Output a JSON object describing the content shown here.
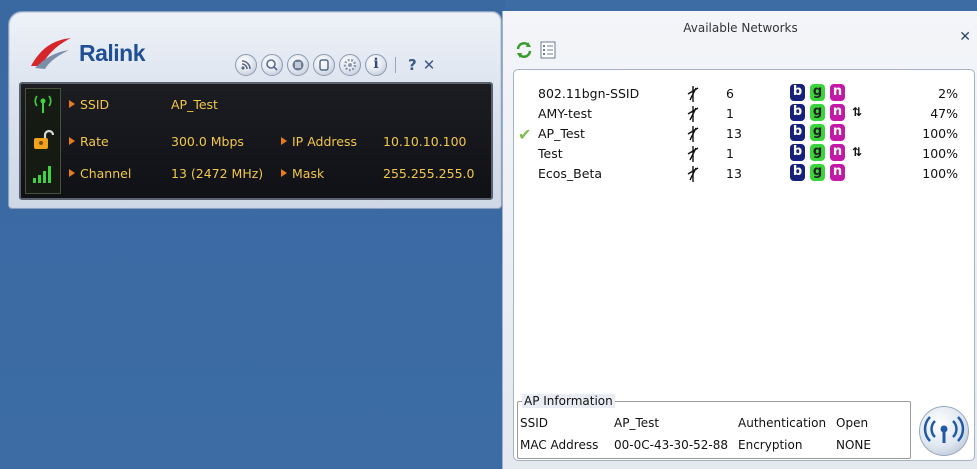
{
  "ralink": {
    "logo_text": "Ralink",
    "toolbar": {
      "icons": [
        "rss-icon",
        "search-icon",
        "list-icon",
        "page-icon",
        "settings-icon",
        "info-icon"
      ],
      "info_glyph": "i",
      "help": "?",
      "close": "✕"
    },
    "info": {
      "ssid_label": "SSID",
      "ssid_value": "AP_Test",
      "rate_label": "Rate",
      "rate_value": "300.0 Mbps",
      "ip_label": "IP Address",
      "ip_value": "10.10.10.100",
      "channel_label": "Channel",
      "channel_value": "13 (2472 MHz)",
      "mask_label": "Mask",
      "mask_value": "255.255.255.0"
    }
  },
  "networks": {
    "title": "Available Networks",
    "close": "✕",
    "list": [
      {
        "ssid": "802.11bgn-SSID",
        "channel": "6",
        "b": "b",
        "g": "g",
        "n": "n",
        "lock": "",
        "signal": "2%",
        "connected": ""
      },
      {
        "ssid": "AMY-test",
        "channel": "1",
        "b": "b",
        "g": "g",
        "n": "n",
        "lock": "⇅",
        "signal": "47%",
        "connected": ""
      },
      {
        "ssid": "AP_Test",
        "channel": "13",
        "b": "b",
        "g": "g",
        "n": "n",
        "lock": "",
        "signal": "100%",
        "connected": "✔"
      },
      {
        "ssid": "Test",
        "channel": "1",
        "b": "b",
        "g": "g",
        "n": "n",
        "lock": "⇅",
        "signal": "100%",
        "connected": ""
      },
      {
        "ssid": "Ecos_Beta",
        "channel": "13",
        "b": "b",
        "g": "g",
        "n": "n",
        "lock": "",
        "signal": "100%",
        "connected": ""
      }
    ],
    "ap_info": {
      "title": "AP Information",
      "ssid_label": "SSID",
      "ssid_value": "AP_Test",
      "auth_label": "Authentication",
      "auth_value": "Open",
      "mac_label": "MAC Address",
      "mac_value": "00-0C-43-30-52-88",
      "enc_label": "Encryption",
      "enc_value": "NONE"
    }
  }
}
